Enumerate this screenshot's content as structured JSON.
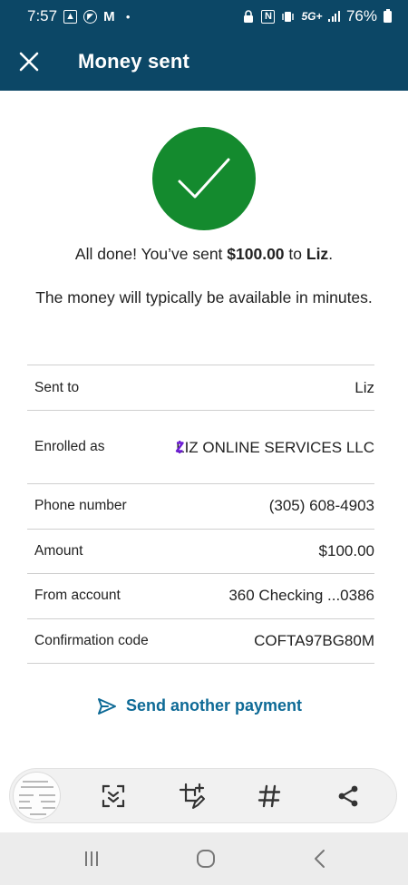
{
  "status_bar": {
    "time": "7:57",
    "network": "5G",
    "network_suffix": "+",
    "battery": "76%",
    "icons": [
      "image-icon",
      "app-icon",
      "gmail-icon",
      "dot-icon",
      "lock-icon",
      "nfc-icon",
      "vibrate-icon",
      "signal-icon",
      "battery-icon"
    ]
  },
  "header": {
    "title": "Money sent",
    "close_icon": "close-icon"
  },
  "confirmation": {
    "line1_prefix": "All done! You’ve sent ",
    "amount": "$100.00",
    "line1_middle": " to ",
    "recipient": "Liz",
    "line1_suffix": ".",
    "line2": "The money will typically be available in minutes."
  },
  "details": [
    {
      "label": "Sent to",
      "value": "Liz"
    },
    {
      "label": "Enrolled as",
      "value": "LIZ ONLINE SERVICES LLC",
      "badge_icon": "zelle-icon"
    },
    {
      "label": "Phone number",
      "value": "(305) 608-4903"
    },
    {
      "label": "Amount",
      "value": "$100.00"
    },
    {
      "label": "From account",
      "value": "360 Checking ...0386"
    },
    {
      "label": "Confirmation code",
      "value": "COFTA97BG80M"
    }
  ],
  "actions": {
    "send_another": "Send another payment"
  },
  "screenshot_toolbar": {
    "items": [
      "screenshot-thumbnail",
      "scroll-capture-icon",
      "crop-edit-icon",
      "hashtag-icon",
      "share-icon"
    ]
  },
  "nav_bar": {
    "items": [
      "recents-icon",
      "home-icon",
      "back-icon"
    ]
  },
  "colors": {
    "header_bg": "#0c4766",
    "success_green": "#148a2e",
    "link_blue": "#0e6a96",
    "zelle_purple": "#6d1ed4"
  }
}
